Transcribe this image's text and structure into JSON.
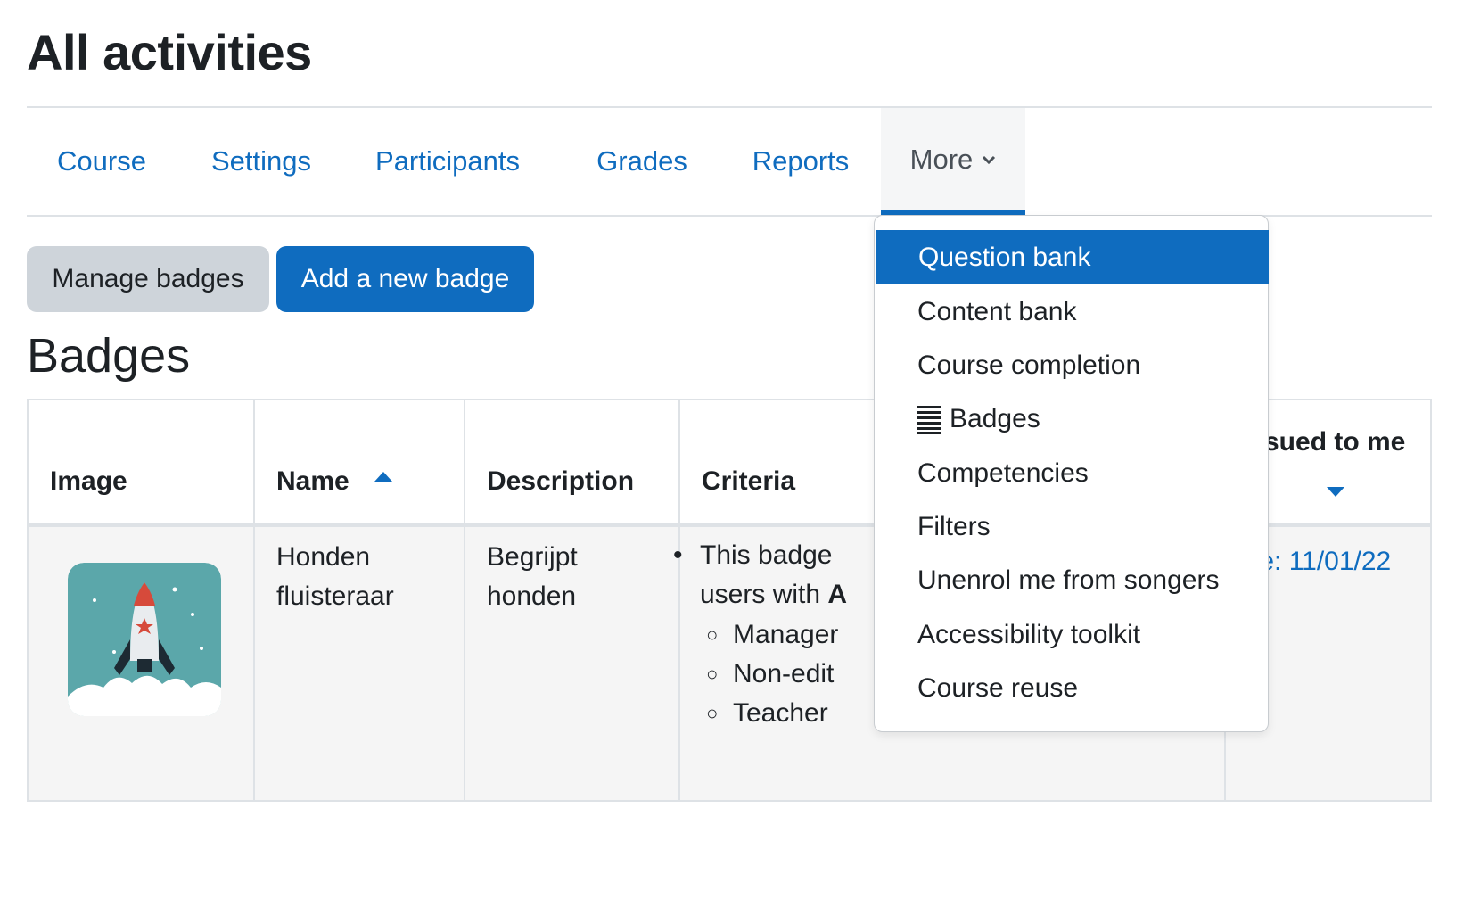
{
  "page": {
    "title": "All activities"
  },
  "nav": {
    "items": [
      {
        "label": "Course"
      },
      {
        "label": "Settings"
      },
      {
        "label": "Participants"
      },
      {
        "label": "Grades"
      },
      {
        "label": "Reports"
      },
      {
        "label": "More"
      }
    ],
    "active_item": "More"
  },
  "actions": {
    "manage_label": "Manage badges",
    "add_label": "Add a new badge"
  },
  "section": {
    "heading": "Badges"
  },
  "table": {
    "headers": {
      "image": "Image",
      "name": "Name",
      "description": "Description",
      "criteria": "Criteria",
      "issued": "sued to me"
    },
    "row": {
      "name_line1": "Honden",
      "name_line2": "fluisteraar",
      "desc_line1": "Begrijpt",
      "desc_line2": "honden",
      "criteria_line1": "This badge",
      "criteria_line2": "users with",
      "criteria_bold": "A",
      "roles": [
        "Manager",
        "Non-edit",
        "Teacher"
      ],
      "issued_date": "te: 11/01/22"
    }
  },
  "dropdown": {
    "items": [
      {
        "label": "Question bank",
        "active": true
      },
      {
        "label": "Content bank"
      },
      {
        "label": "Course completion"
      },
      {
        "label": "Badges",
        "icon": "list-icon"
      },
      {
        "label": "Competencies"
      },
      {
        "label": "Filters"
      },
      {
        "label": "Unenrol me from songers"
      },
      {
        "label": "Accessibility toolkit"
      },
      {
        "label": "Course reuse"
      }
    ]
  },
  "colors": {
    "primary": "#0f6cbf",
    "secondary_btn": "#ced4da",
    "border": "#dee2e6",
    "badge_bg": "#5ba7aa"
  }
}
